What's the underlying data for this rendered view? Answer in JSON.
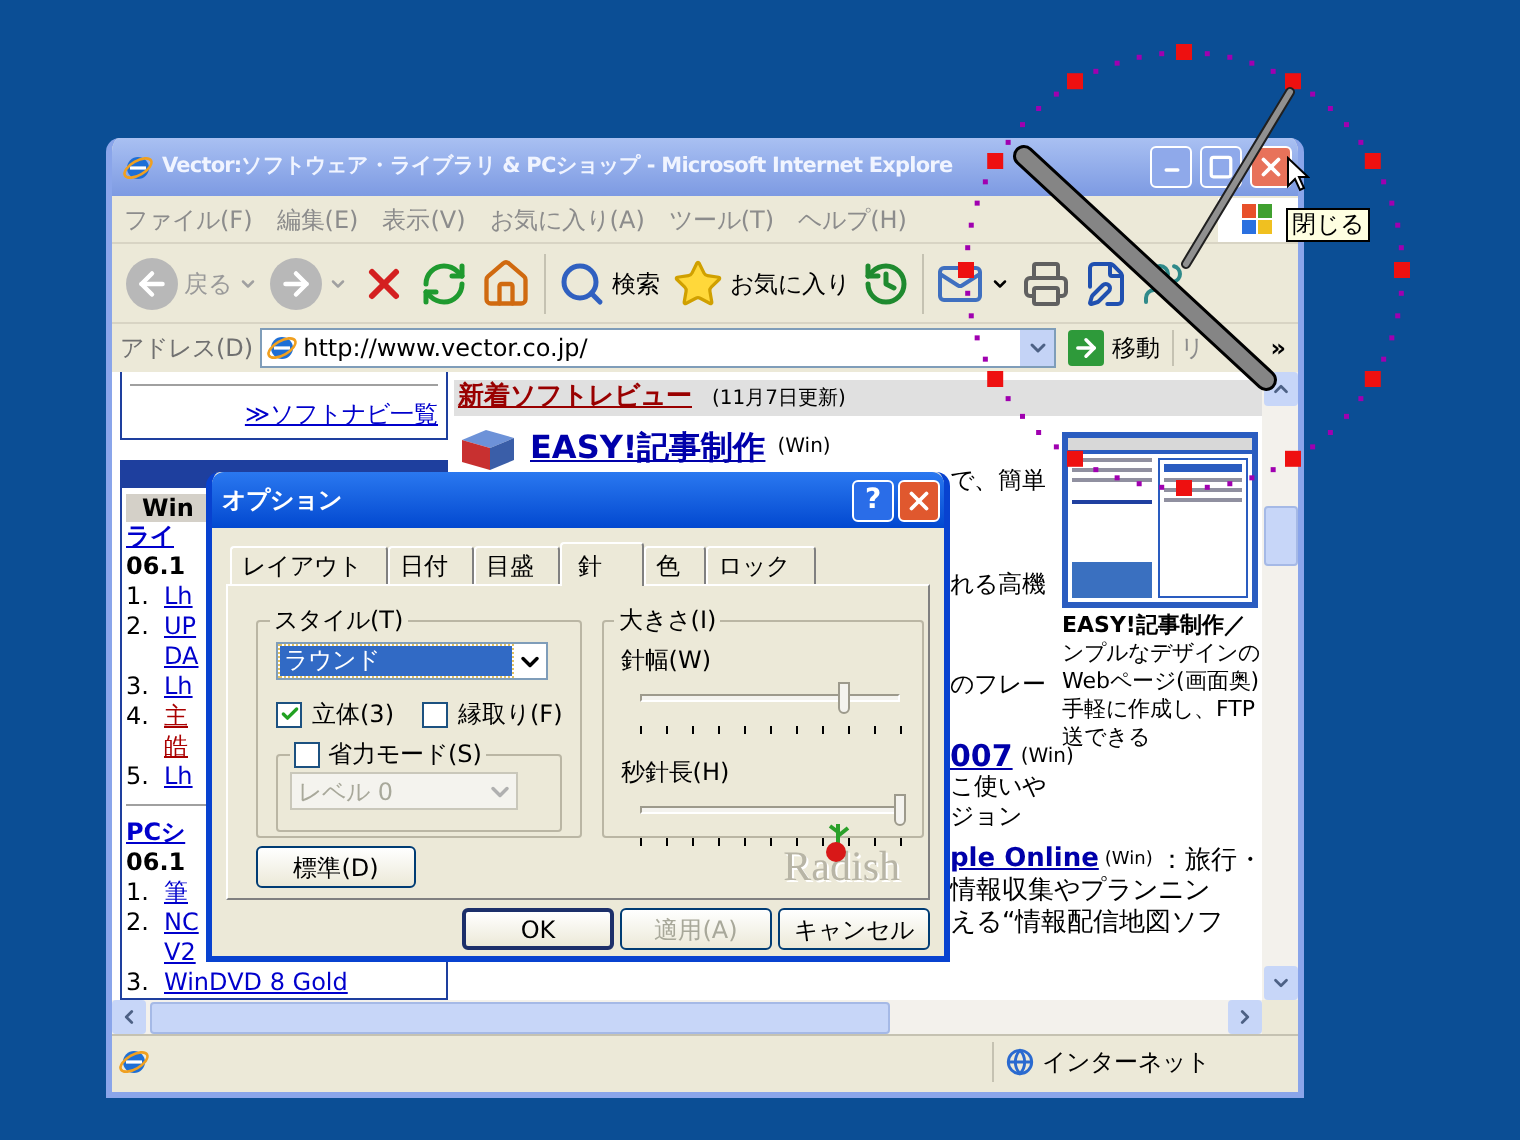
{
  "browser": {
    "title": "Vector:ソフトウェア・ライブラリ & PCショップ - Microsoft Internet Explore",
    "menu": [
      "ファイル(F)",
      "編集(E)",
      "表示(V)",
      "お気に入り(A)",
      "ツール(T)",
      "ヘルプ(H)"
    ],
    "toolbar": [
      {
        "kind": "back",
        "label": "戻る",
        "disabled": true
      },
      {
        "kind": "forward",
        "disabled": true
      },
      {
        "kind": "stop",
        "disabled": false
      },
      {
        "kind": "refresh",
        "disabled": false
      },
      {
        "kind": "home",
        "disabled": false
      },
      {
        "kind": "search",
        "label": "検索",
        "disabled": false
      },
      {
        "kind": "favorites",
        "label": "お気に入り",
        "disabled": false
      },
      {
        "kind": "history",
        "disabled": false
      },
      {
        "kind": "mail",
        "disabled": false
      },
      {
        "kind": "print",
        "disabled": false
      },
      {
        "kind": "edit",
        "disabled": false
      },
      {
        "kind": "messenger",
        "disabled": false
      }
    ],
    "address": {
      "label": "アドレス(D)",
      "value": "http://www.vector.co.jp/",
      "go": "移動",
      "links": "リ",
      "more": "»"
    },
    "status_bar": {
      "zone": "インターネット"
    }
  },
  "page": {
    "left_column": {
      "link": "≫ソフトナビ一覧",
      "sections": [
        {
          "header": "Win",
          "title": "ライ",
          "date": "06.1",
          "items": [
            {
              "number": "1.",
              "lines": [
                "Lh"
              ],
              "color": "#0000cc"
            },
            {
              "number": "2.",
              "lines": [
                "UP",
                "DA"
              ],
              "color": "#0000cc"
            },
            {
              "number": "3.",
              "lines": [
                "Lh"
              ],
              "color": "#0000cc"
            },
            {
              "number": "4.",
              "lines": [
                "主",
                "皓"
              ],
              "color": "#aa0000"
            },
            {
              "number": "5.",
              "lines": [
                "Lh"
              ],
              "color": "#0000cc"
            }
          ]
        },
        {
          "title": "PCシ",
          "date": "06.1",
          "items": [
            {
              "number": "1.",
              "lines": [
                "筆"
              ],
              "color": "#0000cc"
            },
            {
              "number": "2.",
              "lines": [
                "NC",
                "V2"
              ],
              "color": "#0000cc"
            },
            {
              "number": "3.",
              "lines": [
                "WinDVD 8 Gold"
              ],
              "color": "#0000cc"
            }
          ]
        }
      ]
    },
    "news": {
      "heading": "新着ソフトレビュー",
      "updated": "(11月7日更新)",
      "lead_title": "EASY!記事制作",
      "lead_platform": "(Win)",
      "fragments": [
        {
          "kind": "text",
          "text": "で、簡単"
        },
        {
          "kind": "text",
          "text": "れる高機"
        },
        {
          "kind": "text",
          "text": "のフレー"
        },
        {
          "kind": "link",
          "text": "007",
          "platform": "(Win)"
        },
        {
          "kind": "text",
          "text": "こ使いや"
        },
        {
          "kind": "text",
          "text": "ジョン"
        }
      ],
      "wide_rows": [
        {
          "kind": "link",
          "text": "ple Online",
          "platform": "(Win)",
          "after": "：旅行・"
        },
        {
          "kind": "text",
          "text": "情報収集やプランニン"
        },
        {
          "kind": "text",
          "text": "える“情報配信地図ソフ"
        }
      ]
    },
    "feature": {
      "title": "EASY!記事制作／",
      "lines": [
        "ンプルなデザインの",
        "Webページ(画面奥)",
        "手軽に作成し、FTP",
        "送できる"
      ]
    }
  },
  "dialog": {
    "title": "オプション",
    "help": "?",
    "tabs": [
      {
        "label": "レイアウト",
        "selected": false
      },
      {
        "label": "日付",
        "selected": false
      },
      {
        "label": "目盛",
        "selected": false
      },
      {
        "label": "針",
        "selected": true
      },
      {
        "label": "色",
        "selected": false
      },
      {
        "label": "ロック",
        "selected": false
      }
    ],
    "style_group": {
      "label": "スタイル(T)",
      "select": "ラウンド",
      "checkboxes": [
        {
          "label": "立体(3)",
          "checked": true
        },
        {
          "label": "縁取り(F)",
          "checked": false
        }
      ],
      "power_save": {
        "label": "省力モード(S)",
        "checked": false,
        "select": "レベル 0",
        "disabled": true
      }
    },
    "size_group": {
      "label": "大きさ(I)",
      "sliders": [
        {
          "label": "針幅(W)",
          "level": 0.78
        },
        {
          "label": "秒針長(H)",
          "level": 1
        }
      ]
    },
    "reset": "標準(D)",
    "logo": "Radish",
    "buttons": [
      {
        "label": "OK",
        "kind": "default",
        "disabled": false
      },
      {
        "label": "適用(A)",
        "kind": "normal",
        "disabled": true
      },
      {
        "label": "キャンセル",
        "kind": "normal",
        "disabled": false
      }
    ]
  },
  "clock": {
    "tooltip": "閉じる"
  }
}
